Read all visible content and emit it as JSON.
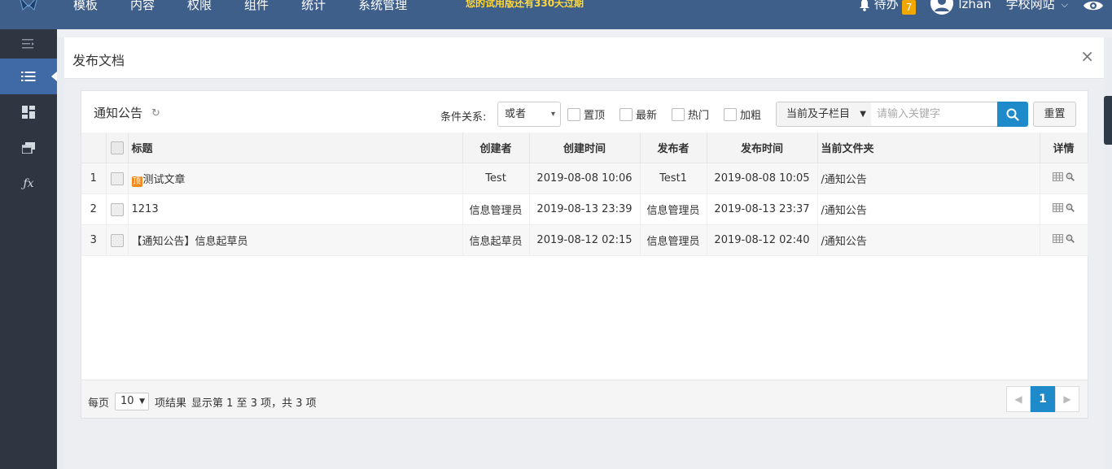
{
  "nav": {
    "items": [
      "模板",
      "内容",
      "权限",
      "组件",
      "统计",
      "系统管理"
    ],
    "trial": "您的试用版还有330天过期"
  },
  "topbar": {
    "todo_label": "待办",
    "todo_count": "7",
    "user": "lzhan",
    "site": "学校网站"
  },
  "modal": {
    "title": "发布文档",
    "close": "×"
  },
  "panel": {
    "title": "通知公告",
    "cond_label": "条件关系:",
    "cond_value": "或者",
    "checks": [
      "置顶",
      "最新",
      "热门",
      "加粗"
    ],
    "scope": "当前及子栏目",
    "search_placeholder": "请输入关键字",
    "reset": "重置"
  },
  "table": {
    "headers": [
      "",
      "",
      "标题",
      "创建者",
      "创建时间",
      "发布者",
      "发布时间",
      "当前文件夹",
      "详情"
    ],
    "rows": [
      {
        "no": "1",
        "badge": "顶",
        "title": "测试文章",
        "creator": "Test",
        "created": "2019-08-08 10:06",
        "publisher": "Test1",
        "published": "2019-08-08 10:05",
        "folder": "/通知公告"
      },
      {
        "no": "2",
        "badge": "",
        "title": "1213",
        "creator": "信息管理员",
        "created": "2019-08-13 23:39",
        "publisher": "信息管理员",
        "published": "2019-08-13 23:37",
        "folder": "/通知公告"
      },
      {
        "no": "3",
        "badge": "",
        "title": "【通知公告】信息起草员",
        "creator": "信息起草员",
        "created": "2019-08-12 02:15",
        "publisher": "信息管理员",
        "published": "2019-08-12 02:40",
        "folder": "/通知公告"
      }
    ]
  },
  "footer": {
    "per_page_label": "每页",
    "per_page_value": "10",
    "per_page_suffix": "项结果",
    "info": "显示第 1 至 3 项，共 3 项",
    "current_page": "1"
  },
  "colors": {
    "topbar": "#3f5f8b",
    "sidebar": "#303641",
    "accent": "#1f8ac9",
    "badge": "#f0a800"
  }
}
